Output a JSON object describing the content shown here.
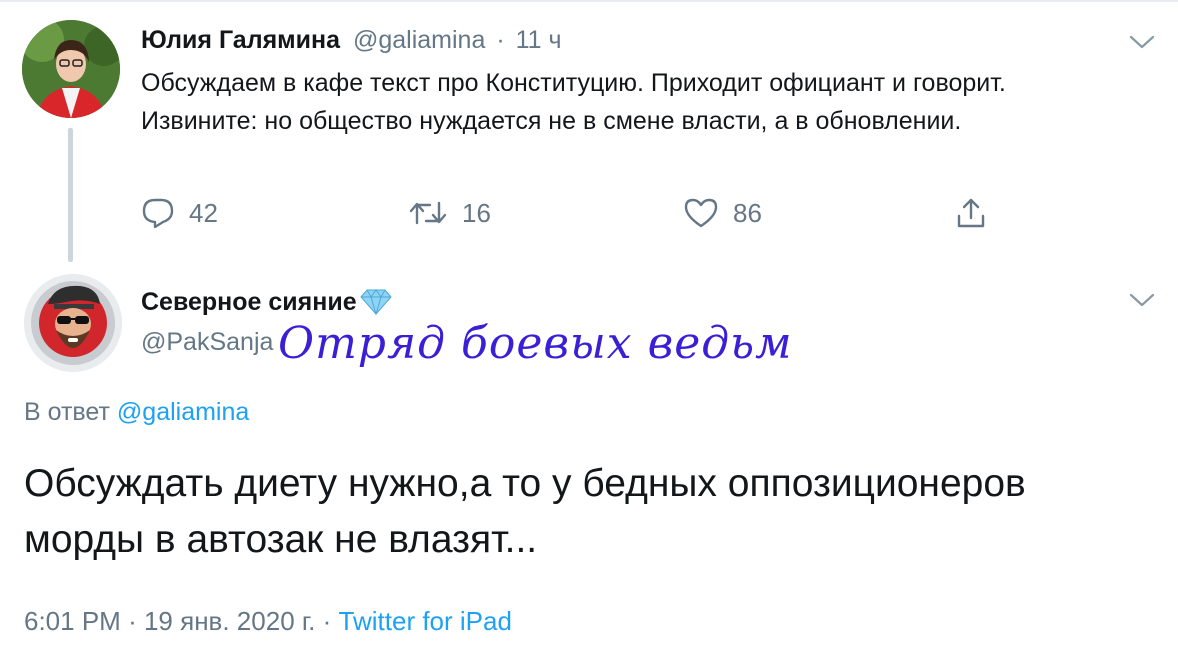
{
  "tweet1": {
    "name": "Юлия Галямина",
    "handle": "@galiamina",
    "sep": "·",
    "time": "11 ч",
    "text": "Обсуждаем в кафе текст про Конституцию. Приходит официант и говорит. Извините: но общество нуждается не в смене власти, а в обновлении.",
    "replies": "42",
    "retweets": "16",
    "likes": "86"
  },
  "tweet2": {
    "name": "Северное сияние",
    "handle": "@PakSanja",
    "overlay": "Отряд боевых ведьм",
    "reply_prefix": "В ответ",
    "reply_handle": "@galiamina",
    "text": "Обсуждать диету нужно,а то у бедных оппозиционеров морды в автозак не влазят...",
    "time": "6:01 PM",
    "date": "19 янв. 2020 г.",
    "sep": "·",
    "source": "Twitter for iPad"
  },
  "icons": {
    "reply": "reply-icon",
    "retweet": "retweet-icon",
    "like": "heart-icon",
    "share": "share-icon",
    "more": "chevron-down-icon",
    "badge": "diamond-icon"
  },
  "colors": {
    "link": "#1da1f2",
    "muted": "#657786",
    "text": "#14171a",
    "overlay_ink": "#3a1fd6"
  }
}
